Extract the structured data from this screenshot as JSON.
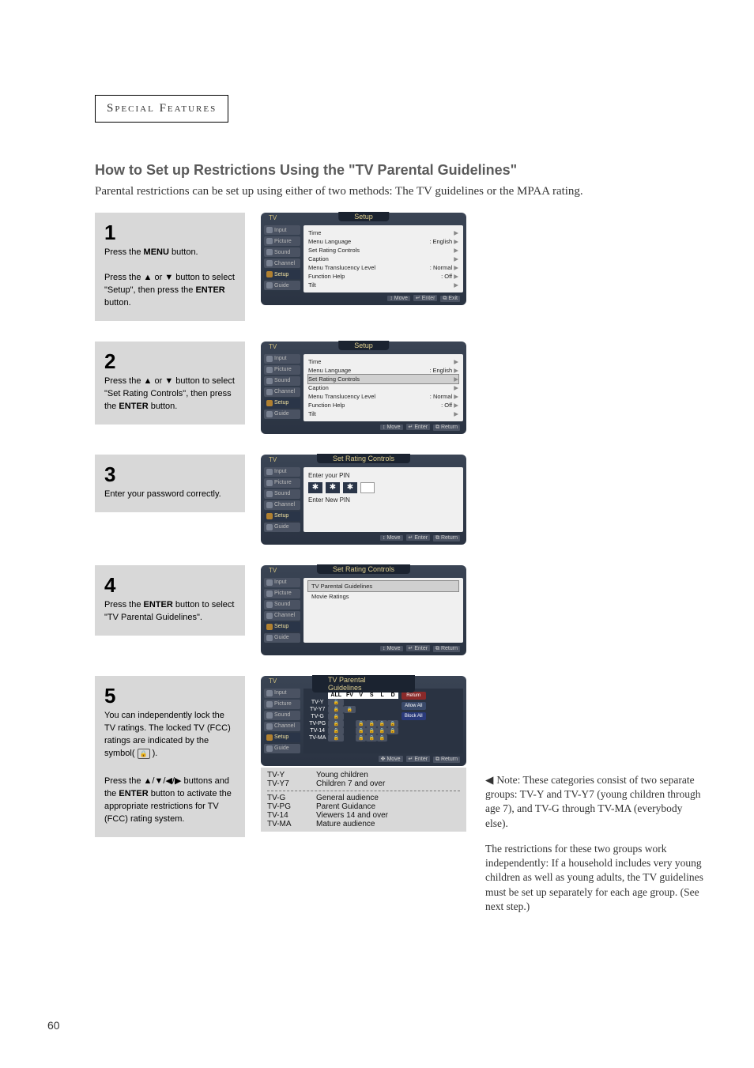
{
  "section_header": "Special Features",
  "main_title": "How to Set up Restrictions Using the \"TV Parental Guidelines\"",
  "intro_text": "Parental restrictions can be set up using either of two methods: The TV guidelines or the MPAA rating.",
  "page_number": "60",
  "steps": {
    "s1": {
      "num": "1",
      "text_p1_a": "Press the ",
      "text_p1_b": "MENU",
      "text_p1_c": " button.",
      "text_p2_a": "Press the ",
      "text_p2_b": " or ",
      "text_p2_c": " button to select \"Setup\", then press the ",
      "text_p2_d": "ENTER",
      "text_p2_e": " button."
    },
    "s2": {
      "num": "2",
      "text_a": "Press the ",
      "text_b": " or ",
      "text_c": " button to select \"Set Rating Controls\", then press the ",
      "text_d": "ENTER",
      "text_e": " button."
    },
    "s3": {
      "num": "3",
      "text": "Enter your password correctly."
    },
    "s4": {
      "num": "4",
      "text_a": "Press the ",
      "text_b": "ENTER",
      "text_c": " button to select \"TV Parental Guidelines\"."
    },
    "s5": {
      "num": "5",
      "text_a": "You can independently lock the TV ratings. The locked TV (FCC) ratings are indicated by the symbol( ",
      "text_b": " ).",
      "extra_a": "Press the ",
      "extra_b": " buttons and the ",
      "extra_c": "ENTER",
      "extra_d": " button to activate the appropriate restrictions for TV (FCC) rating system."
    }
  },
  "osd_common": {
    "tv_label": "TV",
    "tabs": {
      "input": "Input",
      "picture": "Picture",
      "sound": "Sound",
      "channel": "Channel",
      "setup": "Setup",
      "guide": "Guide"
    },
    "foot": {
      "move": "Move",
      "enter": "Enter",
      "exit": "Exit",
      "return": "Return"
    }
  },
  "osd1": {
    "title": "Setup",
    "rows": {
      "time": "Time",
      "menu_lang_l": "Menu Language",
      "menu_lang_v": ": English",
      "set_rating": "Set Rating Controls",
      "caption": "Caption",
      "translucency_l": "Menu Translucency Level",
      "translucency_v": ": Normal",
      "func_help_l": "Function Help",
      "func_help_v": ": Off",
      "tilt": "Tilt"
    }
  },
  "osd3": {
    "title": "Set Rating Controls",
    "enter_pin": "Enter your PIN",
    "enter_new_pin": "Enter New PIN"
  },
  "osd4": {
    "title": "Set Rating Controls",
    "item1": "TV Parental Guidelines",
    "item2": "Movie Ratings"
  },
  "osd5": {
    "title": "TV Parental Guidelines",
    "cols": {
      "all": "ALL",
      "fv": "FV",
      "v": "V",
      "s": "S",
      "l": "L",
      "d": "D"
    },
    "rows": {
      "tvy": "TV-Y",
      "tvy7": "TV-Y7",
      "tvg": "TV-G",
      "tvpg": "TV-PG",
      "tv14": "TV-14",
      "tvma": "TV-MA"
    },
    "btns": {
      "ret": "Return",
      "allow": "Allow All",
      "block": "Block All"
    }
  },
  "legend": {
    "tvy": {
      "c": "TV-Y",
      "d": "Young children"
    },
    "tvy7": {
      "c": "TV-Y7",
      "d": "Children 7 and over"
    },
    "tvg": {
      "c": "TV-G",
      "d": "General audience"
    },
    "tvpg": {
      "c": "TV-PG",
      "d": "Parent Guidance"
    },
    "tv14": {
      "c": "TV-14",
      "d": "Viewers 14 and over"
    },
    "tvma": {
      "c": "TV-MA",
      "d": "Mature audience"
    }
  },
  "side_note": {
    "p1": "Note: These categories consist of two separate groups: TV-Y and TV-Y7 (young children through age 7), and TV-G through TV-MA (everybody else).",
    "p2": "The restrictions for these two groups work independently: If a household includes very young children as well as young adults, the TV guidelines must be set up separately for each age group. (See next step.)"
  }
}
